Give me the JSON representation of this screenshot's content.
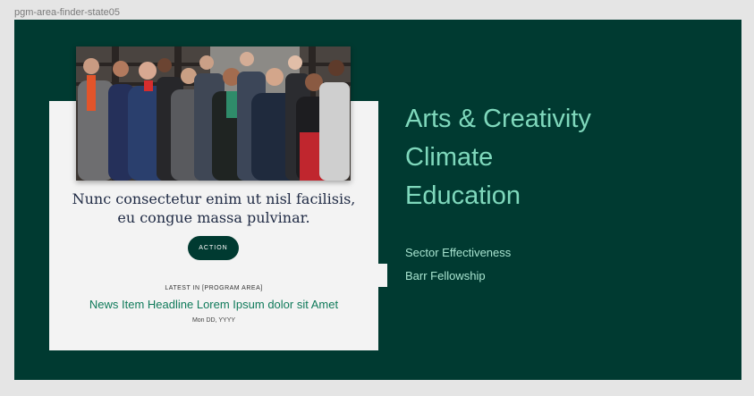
{
  "frame": {
    "label": "pgm-area-finder-state05"
  },
  "colors": {
    "section_bg": "#003a31",
    "accent": "#7fd8bc",
    "card_bg": "#f3f3f3",
    "link": "#0f7a5a"
  },
  "card": {
    "blurb_line1": "Nunc consectetur enim ut nisl facilisis,",
    "blurb_line2": "eu congue massa pulvinar.",
    "action_label": "ACTION",
    "latest_label": "LATEST IN [PROGRAM AREA]",
    "news_headline": "News Item Headline Lorem Ipsum dolor sit Amet",
    "news_date": "Mon DD, YYYY"
  },
  "program_areas": [
    {
      "label": "Arts & Creativity"
    },
    {
      "label": "Climate"
    },
    {
      "label": "Education"
    }
  ],
  "secondary_links": [
    {
      "label": "Sector Effectiveness"
    },
    {
      "label": "Barr Fellowship"
    }
  ]
}
